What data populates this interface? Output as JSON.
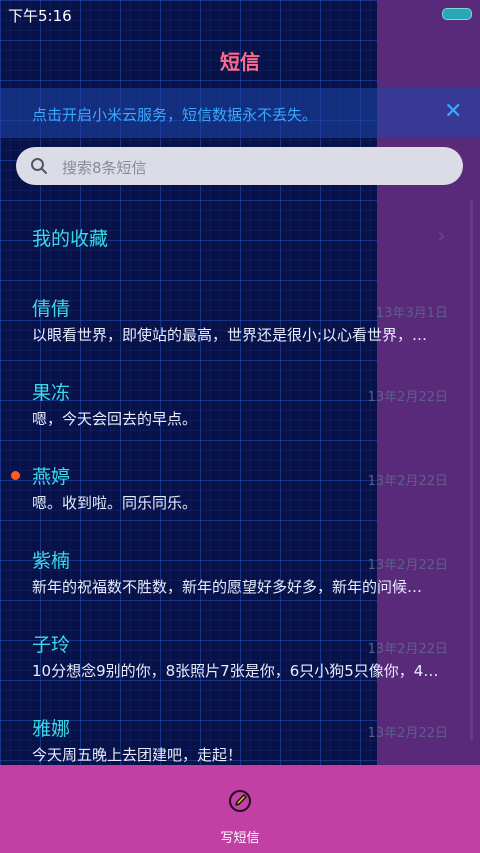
{
  "status": {
    "time": "下午5:16"
  },
  "header": {
    "title": "短信"
  },
  "banner": {
    "text": "点击开启小米云服务，短信数据永不丢失。",
    "close": "✕"
  },
  "search": {
    "placeholder": "搜索8条短信"
  },
  "favorites": {
    "label": "我的收藏",
    "chevron": "›"
  },
  "messages": [
    {
      "name": "倩倩",
      "date": "13年3月1日",
      "preview": "以眼看世界，即使站的最高，世界还是很小;以心看世界，…",
      "unread": false
    },
    {
      "name": "果冻",
      "date": "13年2月22日",
      "preview": "嗯，今天会回去的早点。",
      "unread": false
    },
    {
      "name": "燕婷",
      "date": "13年2月22日",
      "preview": "嗯。收到啦。同乐同乐。",
      "unread": true
    },
    {
      "name": "紫楠",
      "date": "13年2月22日",
      "preview": "新年的祝福数不胜数，新年的愿望好多好多，新年的问候…",
      "unread": false
    },
    {
      "name": "子玲",
      "date": "13年2月22日",
      "preview": "10分想念9别的你，8张照片7张是你，6只小狗5只像你，4…",
      "unread": false
    },
    {
      "name": "雅娜",
      "date": "13年2月22日",
      "preview": "今天周五晚上去团建吧，走起！",
      "unread": false
    }
  ],
  "bottom": {
    "compose_label": "写短信"
  },
  "colors": {
    "accent_cyan": "#39d9e6",
    "title_pink": "#ff6b8a",
    "bottom_bar": "#c23fa4",
    "panel_purple": "#5a2a7a",
    "unread_dot": "#ff5a24"
  }
}
